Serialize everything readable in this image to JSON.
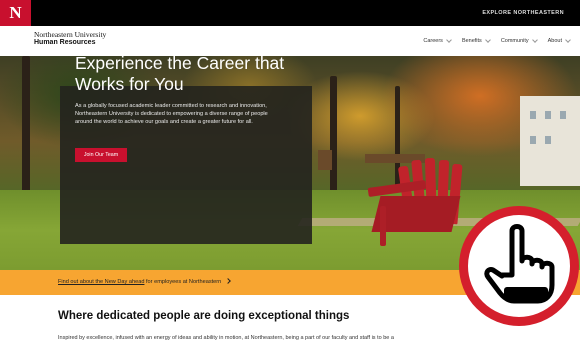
{
  "topbar": {
    "logo": "N",
    "explore_label": "EXPLORE NORTHEASTERN"
  },
  "brand": {
    "line1": "Northeastern University",
    "line2": "Human Resources"
  },
  "nav": {
    "items": [
      {
        "label": "Careers"
      },
      {
        "label": "Benefits"
      },
      {
        "label": "Community"
      },
      {
        "label": "About"
      }
    ]
  },
  "hero": {
    "title": "Experience the Career that Works for You",
    "description": "As a globally focused academic leader committed to research and innovation, Northeastern University is dedicated to empowering a diverse range of people around the world to achieve our goals and create a greater future for all.",
    "cta_label": "Join Our Team"
  },
  "announcement": {
    "link_text": "Find out about the New Day ahead",
    "rest_text": " for employees at Northeastern"
  },
  "section": {
    "title": "Where dedicated people are doing exceptional things",
    "text": "Inspired by excellence, infused with an energy of ideas and ability in motion, at Northeastern, being a part of our faculty and staff is to be a"
  },
  "icons": {
    "chevron": "chevron-down-icon",
    "announce_chevron": "chevron-right-icon",
    "pointer": "hand-pointer-icon"
  },
  "colors": {
    "brand_red": "#c8102e",
    "announce_bg": "#f7a531",
    "topbar_bg": "#000000"
  }
}
